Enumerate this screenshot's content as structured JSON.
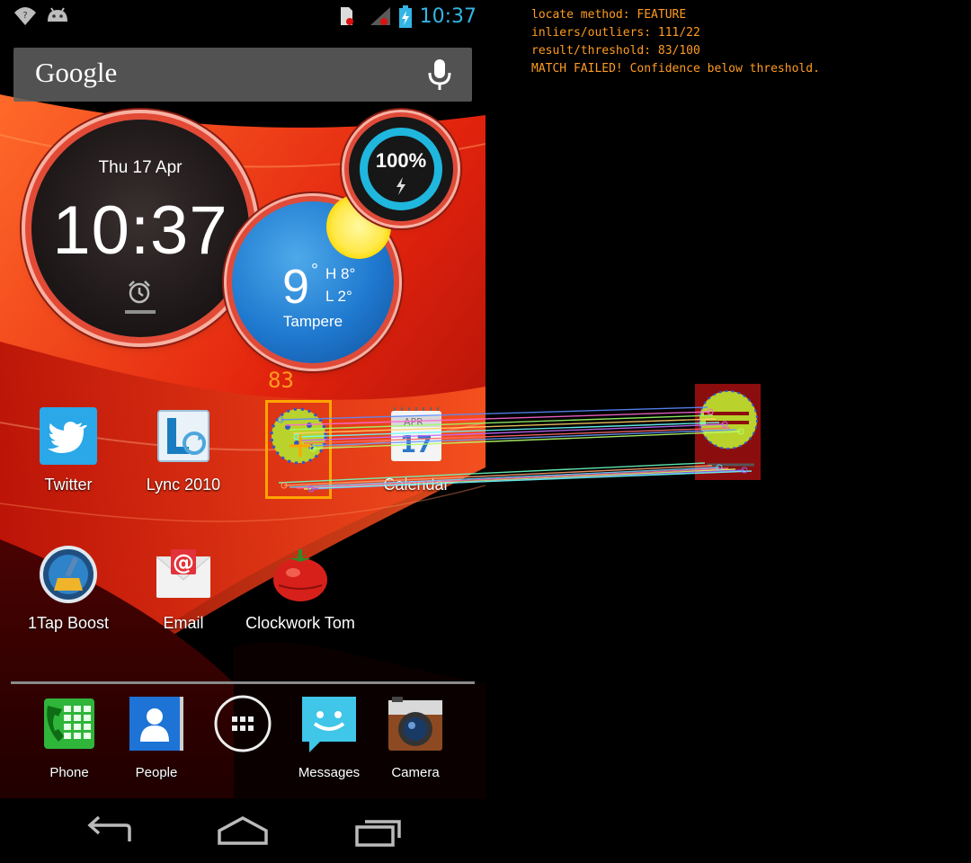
{
  "status_bar": {
    "time": "10:37",
    "left_icons": [
      "wifi-question-icon",
      "android-debug-icon"
    ],
    "right_icons": [
      "sim-card-icon",
      "signal-icon",
      "battery-charging-icon"
    ]
  },
  "search_bar": {
    "logo_text": "Google",
    "icon": "mic-icon"
  },
  "clock_widget": {
    "date": "Thu 17 Apr",
    "time": "10:37",
    "icon": "alarm-clock-icon"
  },
  "battery_widget": {
    "percent_text": "100%",
    "level": 1.0,
    "icon": "bolt-icon"
  },
  "weather_widget": {
    "temperature": "9",
    "degree_symbol": "°",
    "high": "H 8°",
    "low": "L 2°",
    "city": "Tampere",
    "icon": "sun-icon"
  },
  "apps_row1": [
    {
      "label": "Twitter",
      "icon": "twitter-bird-icon"
    },
    {
      "label": "Lync 2010",
      "icon": "lync-icon"
    },
    {
      "label": "",
      "icon": "matched-target-icon"
    },
    {
      "label": "Calendar",
      "icon": "calendar-icon",
      "icon_text_month": "APR",
      "icon_text_day": "17"
    }
  ],
  "apps_row2": [
    {
      "label": "1Tap Boost",
      "icon": "broom-icon"
    },
    {
      "label": "Email",
      "icon": "email-envelope-icon"
    },
    {
      "label": "Clockwork Tom",
      "icon": "tomato-timer-icon"
    }
  ],
  "dock": [
    {
      "label": "Phone",
      "icon": "phone-dialpad-icon"
    },
    {
      "label": "People",
      "icon": "contacts-icon"
    },
    {
      "label": "",
      "icon": "app-drawer-icon"
    },
    {
      "label": "Messages",
      "icon": "messages-icon"
    },
    {
      "label": "Camera",
      "icon": "camera-icon"
    }
  ],
  "nav_bar": {
    "icons": [
      "back-icon",
      "home-icon",
      "recents-icon"
    ]
  },
  "overlay": {
    "lines": [
      "locate method: FEATURE",
      "inliers/outliers: 111/22",
      "result/threshold: 83/100",
      "MATCH FAILED! Confidence below threshold."
    ],
    "match_score": "83",
    "colors": {
      "overlay_text": "#ff9b21",
      "match_box": "#ffa500",
      "thumb_bg": "#8c0d0d"
    }
  },
  "colors": {
    "accent_blue": "#33b5e5",
    "widget_ring_red": "#e04a38",
    "battery_ring": "#1fb7de"
  }
}
